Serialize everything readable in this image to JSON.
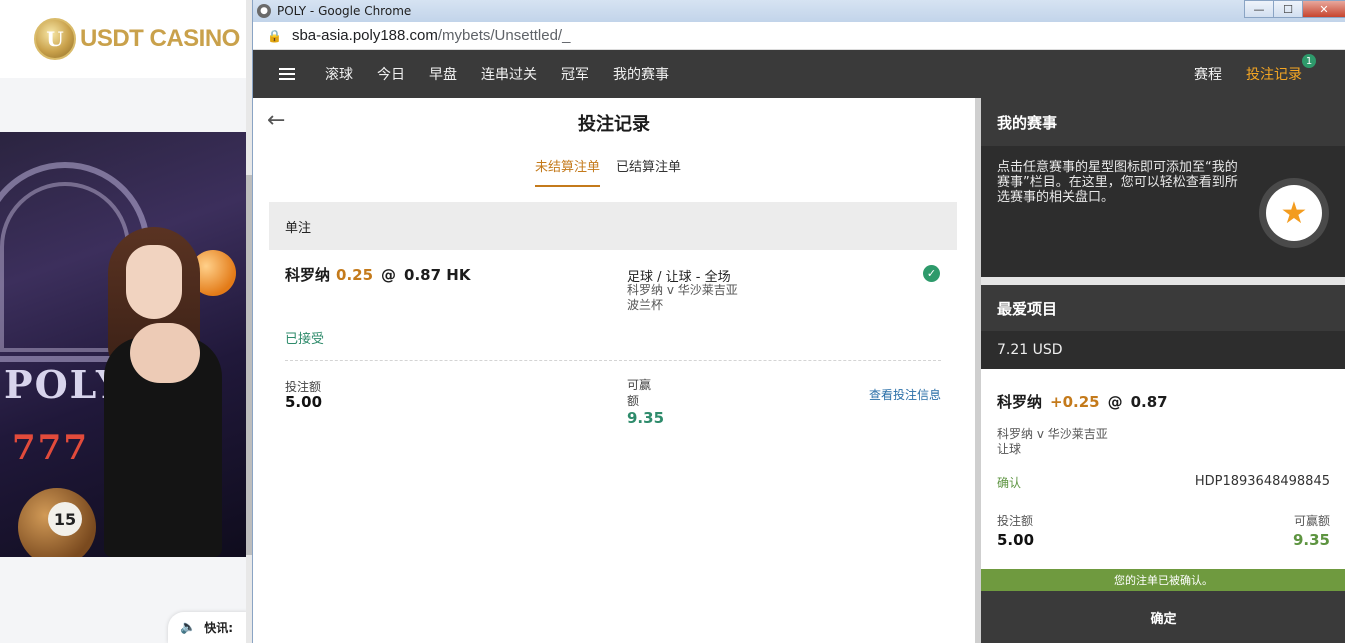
{
  "background_page": {
    "logo_text": "USDT CASINO",
    "logo_mark": "U",
    "banner_text": "POLY",
    "banner_777": "777",
    "ball_number": "15",
    "bottom_pill_label": "快讯:"
  },
  "window": {
    "title": "POLY - Google Chrome",
    "url_host": "sba-asia.poly188.com",
    "url_path": "/mybets/Unsettled/_",
    "controls": {
      "minimize": "—",
      "maximize": "☐",
      "close": "✕"
    }
  },
  "nav": {
    "items": [
      "滚球",
      "今日",
      "早盘",
      "连串过关",
      "冠军",
      "我的赛事"
    ],
    "right_items": [
      "赛程",
      "投注记录"
    ],
    "badge_count": "1"
  },
  "main": {
    "title": "投注记录",
    "tabs": [
      "未结算注单",
      "已结算注单"
    ],
    "section_title": "单注",
    "bet": {
      "selection": "科罗纳",
      "handicap": "0.25",
      "at": "@",
      "odds": "0.87 HK",
      "market": "足球 / 让球 - 全场",
      "match": "科罗纳 v 华沙莱吉亚",
      "league": "波兰杯",
      "status": "已接受",
      "stake_label": "投注额",
      "stake_value": "5.00",
      "win_label": "可赢额",
      "win_value": "9.35",
      "view_info": "查看投注信息"
    }
  },
  "sidebar": {
    "my_events_title": "我的赛事",
    "my_events_text": "点击任意赛事的星型图标即可添加至“我的赛事”栏目。在这里，您可以轻松查看到所选赛事的相关盘口。",
    "favorites_title": "最爱项目",
    "balance": "7.21 USD",
    "slip": {
      "selection": "科罗纳",
      "handicap": "+0.25",
      "at": "@",
      "odds": "0.87",
      "match": "科罗纳 v 华沙莱吉亚",
      "market": "让球",
      "confirm_label": "确认",
      "ticket_id": "HDP1893648498845",
      "stake_label": "投注额",
      "stake_value": "5.00",
      "win_label": "可赢额",
      "win_value": "9.35"
    },
    "confirmed_message": "您的注单已被确认。",
    "ok_button": "确定"
  },
  "colors": {
    "accent_orange": "#c47a1b",
    "nav_active": "#f5a623",
    "success_green": "#2e9a6b",
    "confirm_green": "#6f9a3f",
    "dark_header": "#3a3a3a"
  }
}
